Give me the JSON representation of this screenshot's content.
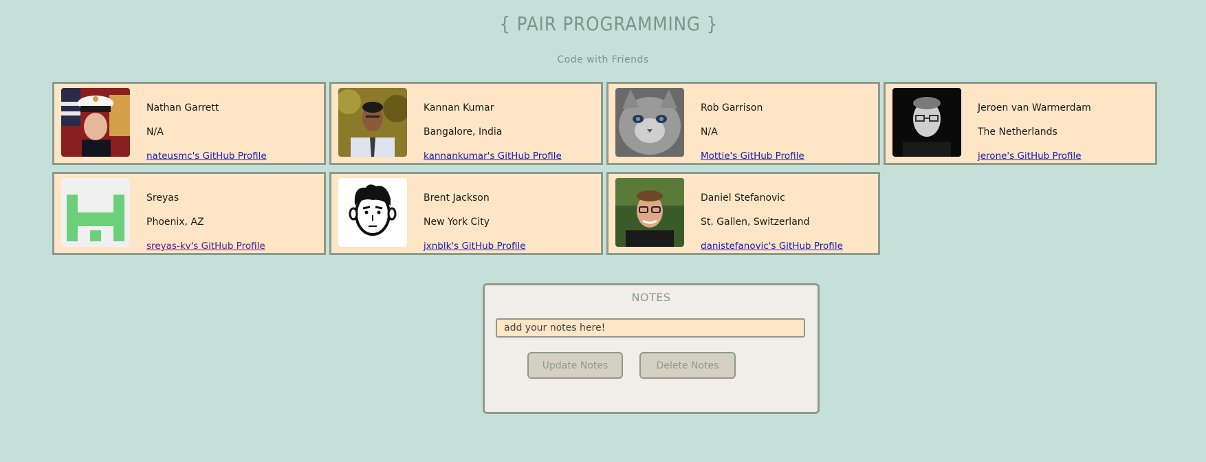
{
  "header": {
    "title": "{ PAIR PROGRAMMING }",
    "subtitle": "Code with Friends"
  },
  "users": [
    {
      "name": "Nathan Garrett",
      "location": "N/A",
      "link": "nateusmc's GitHub Profile",
      "avatar": "marine-portrait"
    },
    {
      "name": "Kannan Kumar",
      "location": "Bangalore, India",
      "link": "kannankumar's GitHub Profile",
      "avatar": "man-in-tie-portrait"
    },
    {
      "name": "Rob Garrison",
      "location": "N/A",
      "link": "Mottie's GitHub Profile",
      "avatar": "grey-cat-portrait"
    },
    {
      "name": "Jeroen van Warmerdam",
      "location": "The Netherlands",
      "link": "jerone's GitHub Profile",
      "avatar": "bw-man-glasses-portrait"
    },
    {
      "name": "Sreyas",
      "location": "Phoenix, AZ",
      "link": "sreyas-kv's GitHub Profile",
      "avatar": "green-identicon"
    },
    {
      "name": "Brent Jackson",
      "location": "New York City",
      "link": "jxnblk's GitHub Profile",
      "avatar": "cartoon-face"
    },
    {
      "name": "Daniel Stefanovic",
      "location": "St. Gallen, Switzerland",
      "link": "danistefanovic's GitHub Profile",
      "avatar": "man-glasses-portrait"
    }
  ],
  "notes": {
    "title": "NOTES",
    "placeholder": "add your notes here!",
    "update_label": "Update Notes",
    "delete_label": "Delete Notes"
  }
}
